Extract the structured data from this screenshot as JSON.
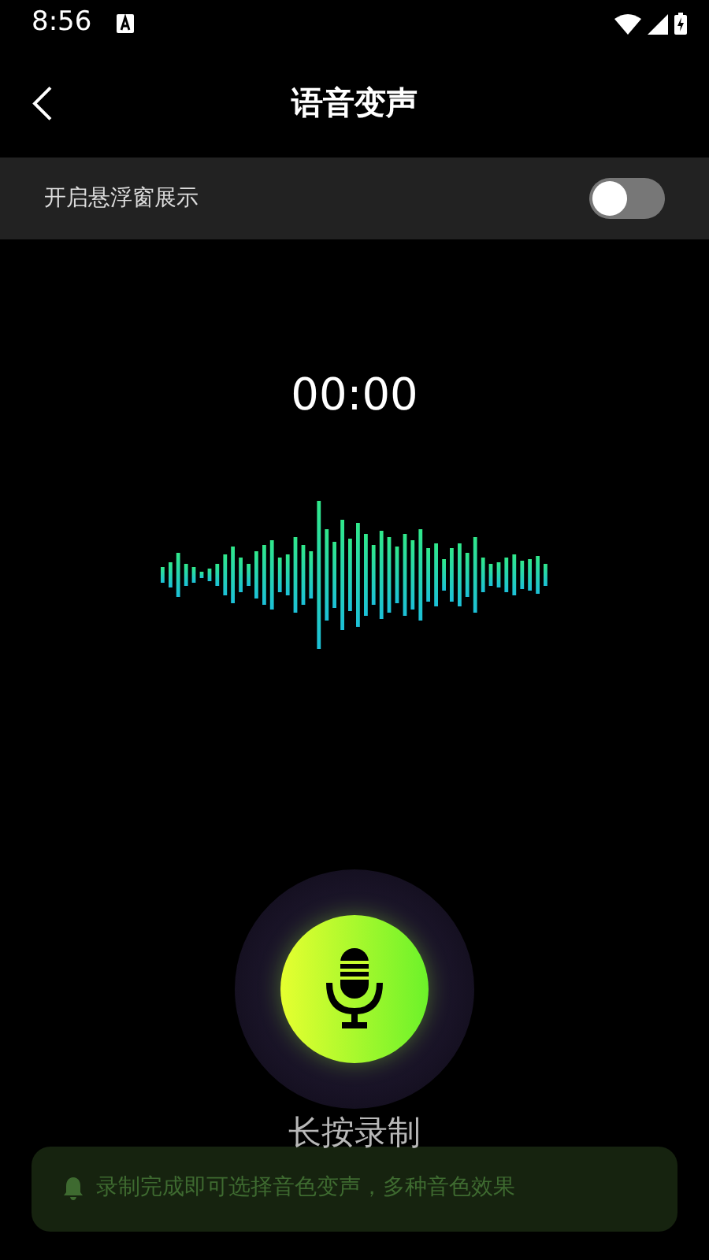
{
  "status_bar": {
    "time": "8:56"
  },
  "header": {
    "title": "语音变声"
  },
  "floating_window": {
    "label": "开启悬浮窗展示",
    "on": false
  },
  "timer": "00:00",
  "record_button": {
    "label": "长按录制"
  },
  "notice": {
    "text": "录制完成即可选择音色变声，多种音色效果"
  }
}
